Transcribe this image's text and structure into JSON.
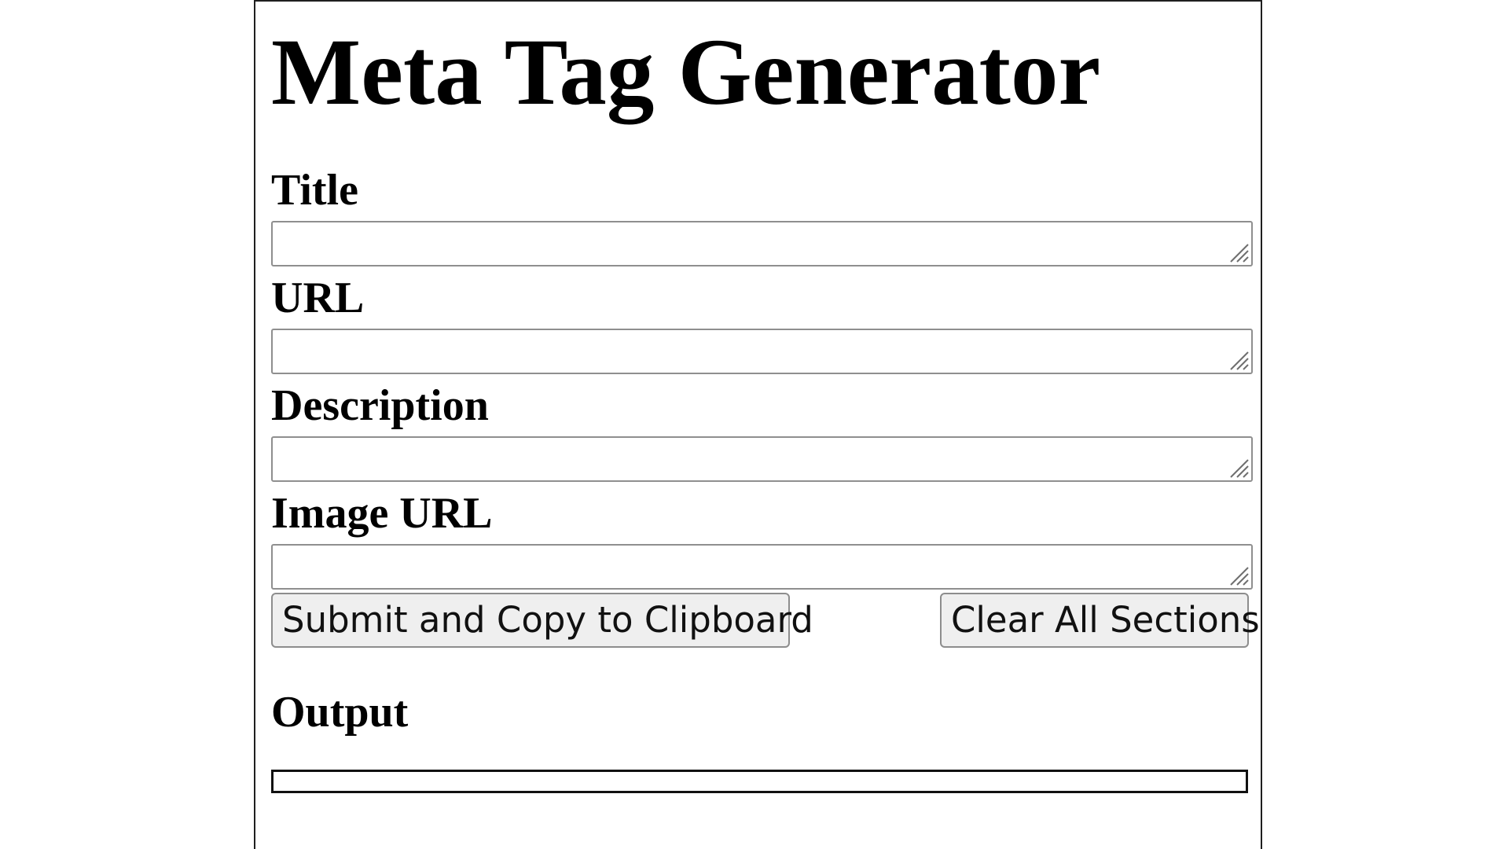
{
  "app": {
    "title": "Meta Tag Generator"
  },
  "form": {
    "fields": [
      {
        "label": "Title",
        "value": ""
      },
      {
        "label": "URL",
        "value": ""
      },
      {
        "label": "Description",
        "value": ""
      },
      {
        "label": "Image URL",
        "value": ""
      }
    ]
  },
  "actions": {
    "submit_label": "Submit and Copy to Clipboard",
    "clear_label": "Clear All Sections"
  },
  "output": {
    "heading": "Output",
    "value": ""
  },
  "colors": {
    "border": "#8f8f8f",
    "button_bg": "#efefef",
    "text": "#000000"
  }
}
